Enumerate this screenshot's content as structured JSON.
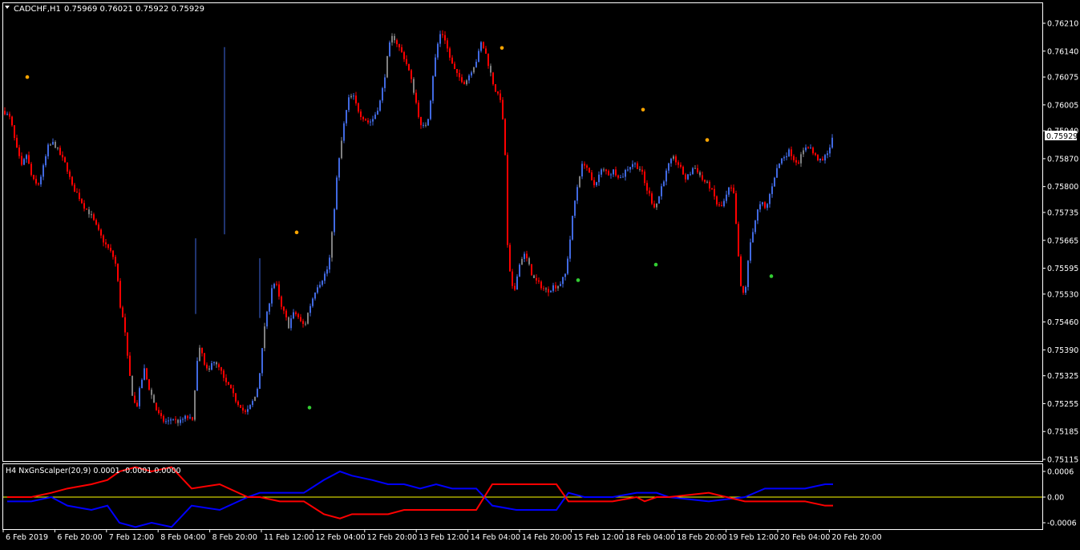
{
  "window": {
    "symbol_title": "CADCHF,H1",
    "quote": "0.75969 0.76021 0.75922 0.75929",
    "current_price_label": "0.75929"
  },
  "indicator": {
    "title": "H4 NxGnScalper(20,9) 0.0001 -0.0001 0.0000"
  },
  "colors": {
    "background": "#000000",
    "frame": "#ffffff",
    "bull_candle": "#4169e1",
    "bear_candle": "#ff0000",
    "neutral_candle": "#808080",
    "signal_sell": "#ffa500",
    "signal_buy": "#32cd32",
    "indicator_blue": "#0000ff",
    "indicator_red": "#ff0000",
    "zero_line": "#ffff00"
  },
  "chart_data": [
    {
      "type": "candlestick",
      "symbol": "CADCHF",
      "timeframe": "H1",
      "ohlc_last": {
        "open": 0.75969,
        "high": 0.76021,
        "low": 0.75922,
        "close": 0.75929
      },
      "y_ticks": [
        "0.76210",
        "0.76140",
        "0.76075",
        "0.76005",
        "0.75940",
        "0.75870",
        "0.75800",
        "0.75735",
        "0.75665",
        "0.75595",
        "0.75530",
        "0.75460",
        "0.75390",
        "0.75325",
        "0.75255",
        "0.75185",
        "0.75115"
      ],
      "ylim": [
        0.75115,
        0.7621
      ],
      "x_ticks": [
        "6 Feb 2019",
        "6 Feb 20:00",
        "7 Feb 12:00",
        "8 Feb 04:00",
        "8 Feb 20:00",
        "11 Feb 12:00",
        "12 Feb 04:00",
        "12 Feb 20:00",
        "13 Feb 12:00",
        "14 Feb 04:00",
        "14 Feb 20:00",
        "15 Feb 12:00",
        "18 Feb 04:00",
        "18 Feb 20:00",
        "19 Feb 12:00",
        "20 Feb 04:00",
        "20 Feb 20:00"
      ],
      "close_path": [
        [
          0,
          0.7599
        ],
        [
          8,
          0.7597
        ],
        [
          15,
          0.759
        ],
        [
          22,
          0.7585
        ],
        [
          28,
          0.7588
        ],
        [
          35,
          0.7582
        ],
        [
          42,
          0.758
        ],
        [
          48,
          0.7584
        ],
        [
          55,
          0.759
        ],
        [
          62,
          0.7591
        ],
        [
          70,
          0.7588
        ],
        [
          78,
          0.7585
        ],
        [
          85,
          0.758
        ],
        [
          92,
          0.7578
        ],
        [
          100,
          0.7575
        ],
        [
          108,
          0.7573
        ],
        [
          115,
          0.757
        ],
        [
          122,
          0.7567
        ],
        [
          128,
          0.7565
        ],
        [
          135,
          0.7563
        ],
        [
          140,
          0.756
        ],
        [
          145,
          0.755
        ],
        [
          150,
          0.7545
        ],
        [
          155,
          0.7535
        ],
        [
          160,
          0.7528
        ],
        [
          165,
          0.7524
        ],
        [
          170,
          0.753
        ],
        [
          175,
          0.7534
        ],
        [
          180,
          0.753
        ],
        [
          185,
          0.7527
        ],
        [
          190,
          0.7524
        ],
        [
          195,
          0.7522
        ],
        [
          200,
          0.7521
        ],
        [
          205,
          0.7521
        ],
        [
          210,
          0.7522
        ],
        [
          215,
          0.7521
        ],
        [
          220,
          0.7521
        ],
        [
          225,
          0.7522
        ],
        [
          230,
          0.7522
        ],
        [
          235,
          0.7521
        ],
        [
          240,
          0.7535
        ],
        [
          245,
          0.754
        ],
        [
          250,
          0.7535
        ],
        [
          255,
          0.7533
        ],
        [
          260,
          0.7537
        ],
        [
          265,
          0.7535
        ],
        [
          270,
          0.7534
        ],
        [
          275,
          0.7531
        ],
        [
          280,
          0.753
        ],
        [
          285,
          0.7528
        ],
        [
          290,
          0.7526
        ],
        [
          295,
          0.7525
        ],
        [
          300,
          0.7523
        ],
        [
          305,
          0.7524
        ],
        [
          310,
          0.7526
        ],
        [
          315,
          0.7528
        ],
        [
          320,
          0.7535
        ],
        [
          325,
          0.7545
        ],
        [
          330,
          0.755
        ],
        [
          335,
          0.7556
        ],
        [
          340,
          0.7555
        ],
        [
          345,
          0.755
        ],
        [
          350,
          0.7548
        ],
        [
          355,
          0.7545
        ],
        [
          360,
          0.7548
        ],
        [
          365,
          0.7548
        ],
        [
          370,
          0.7546
        ],
        [
          375,
          0.7545
        ],
        [
          380,
          0.7549
        ],
        [
          385,
          0.7552
        ],
        [
          390,
          0.7555
        ],
        [
          395,
          0.7556
        ],
        [
          400,
          0.7558
        ],
        [
          405,
          0.756
        ],
        [
          410,
          0.757
        ],
        [
          415,
          0.7582
        ],
        [
          420,
          0.759
        ],
        [
          425,
          0.7597
        ],
        [
          430,
          0.7602
        ],
        [
          435,
          0.7603
        ],
        [
          440,
          0.76
        ],
        [
          445,
          0.7598
        ],
        [
          450,
          0.7597
        ],
        [
          455,
          0.7596
        ],
        [
          460,
          0.7597
        ],
        [
          465,
          0.7599
        ],
        [
          470,
          0.7602
        ],
        [
          475,
          0.7608
        ],
        [
          480,
          0.7615
        ],
        [
          485,
          0.7618
        ],
        [
          490,
          0.7616
        ],
        [
          495,
          0.7614
        ],
        [
          500,
          0.7612
        ],
        [
          505,
          0.7609
        ],
        [
          510,
          0.7605
        ],
        [
          515,
          0.76
        ],
        [
          520,
          0.7595
        ],
        [
          525,
          0.7595
        ],
        [
          530,
          0.7598
        ],
        [
          535,
          0.7608
        ],
        [
          540,
          0.7615
        ],
        [
          545,
          0.7619
        ],
        [
          550,
          0.7617
        ],
        [
          555,
          0.7613
        ],
        [
          560,
          0.761
        ],
        [
          565,
          0.7608
        ],
        [
          570,
          0.7607
        ],
        [
          575,
          0.7606
        ],
        [
          580,
          0.7608
        ],
        [
          585,
          0.761
        ],
        [
          590,
          0.7612
        ],
        [
          595,
          0.7616
        ],
        [
          600,
          0.7614
        ],
        [
          605,
          0.761
        ],
        [
          610,
          0.7606
        ],
        [
          615,
          0.7603
        ],
        [
          620,
          0.7602
        ],
        [
          625,
          0.7588
        ],
        [
          628,
          0.7565
        ],
        [
          632,
          0.7556
        ],
        [
          636,
          0.7553
        ],
        [
          640,
          0.7558
        ],
        [
          645,
          0.7562
        ],
        [
          650,
          0.7563
        ],
        [
          655,
          0.756
        ],
        [
          660,
          0.7557
        ],
        [
          665,
          0.7556
        ],
        [
          670,
          0.7555
        ],
        [
          675,
          0.7554
        ],
        [
          680,
          0.7554
        ],
        [
          685,
          0.7555
        ],
        [
          690,
          0.7555
        ],
        [
          695,
          0.7556
        ],
        [
          700,
          0.7558
        ],
        [
          705,
          0.7565
        ],
        [
          710,
          0.7574
        ],
        [
          715,
          0.758
        ],
        [
          720,
          0.7585
        ],
        [
          725,
          0.7586
        ],
        [
          730,
          0.7583
        ],
        [
          735,
          0.758
        ],
        [
          740,
          0.7582
        ],
        [
          745,
          0.7584
        ],
        [
          750,
          0.7584
        ],
        [
          755,
          0.7583
        ],
        [
          760,
          0.7584
        ],
        [
          765,
          0.7583
        ],
        [
          770,
          0.7582
        ],
        [
          775,
          0.7584
        ],
        [
          780,
          0.7585
        ],
        [
          785,
          0.7586
        ],
        [
          790,
          0.7585
        ],
        [
          795,
          0.7584
        ],
        [
          800,
          0.758
        ],
        [
          805,
          0.7578
        ],
        [
          810,
          0.7575
        ],
        [
          815,
          0.7576
        ],
        [
          820,
          0.758
        ],
        [
          825,
          0.7583
        ],
        [
          830,
          0.7586
        ],
        [
          835,
          0.7587
        ],
        [
          840,
          0.7586
        ],
        [
          845,
          0.7584
        ],
        [
          850,
          0.7582
        ],
        [
          855,
          0.7583
        ],
        [
          860,
          0.7585
        ],
        [
          865,
          0.7584
        ],
        [
          870,
          0.7582
        ],
        [
          875,
          0.7581
        ],
        [
          880,
          0.758
        ],
        [
          885,
          0.7578
        ],
        [
          890,
          0.7575
        ],
        [
          895,
          0.7575
        ],
        [
          900,
          0.7577
        ],
        [
          905,
          0.758
        ],
        [
          910,
          0.7578
        ],
        [
          915,
          0.7565
        ],
        [
          920,
          0.7552
        ],
        [
          925,
          0.7555
        ],
        [
          930,
          0.7565
        ],
        [
          935,
          0.757
        ],
        [
          940,
          0.7574
        ],
        [
          945,
          0.7576
        ],
        [
          950,
          0.7574
        ],
        [
          955,
          0.7578
        ],
        [
          960,
          0.7582
        ],
        [
          965,
          0.7585
        ],
        [
          970,
          0.7587
        ],
        [
          975,
          0.7588
        ],
        [
          980,
          0.7589
        ],
        [
          985,
          0.7587
        ],
        [
          990,
          0.7586
        ],
        [
          995,
          0.7588
        ],
        [
          1000,
          0.759
        ],
        [
          1005,
          0.759
        ],
        [
          1010,
          0.7588
        ],
        [
          1015,
          0.7587
        ],
        [
          1020,
          0.7586
        ],
        [
          1025,
          0.7588
        ],
        [
          1030,
          0.759
        ],
        [
          1035,
          0.7593
        ]
      ],
      "tall_spikes": [
        [
          276,
          0.7568,
          0.7615
        ],
        [
          240,
          0.7548,
          0.7567
        ],
        [
          320,
          0.7547,
          0.7562
        ]
      ],
      "signals_sell": [
        [
          30,
          0.76075
        ],
        [
          366,
          0.75685
        ],
        [
          622,
          0.76148
        ],
        [
          798,
          0.75993
        ],
        [
          878,
          0.75917
        ]
      ],
      "signals_buy": [
        [
          382,
          0.75245
        ],
        [
          717,
          0.75565
        ],
        [
          814,
          0.75604
        ],
        [
          958,
          0.75575
        ]
      ]
    },
    {
      "type": "line",
      "name": "H4 NxGnScalper(20,9)",
      "values_shown": [
        0.0001,
        -0.0001,
        0.0
      ],
      "y_ticks": [
        "0.0006",
        "0.00",
        "-0.0006"
      ],
      "ylim": [
        -0.0006,
        0.0006
      ],
      "series": [
        {
          "name": "",
          "color": "#0000ff",
          "steps": [
            [
              5,
              -0.0001
            ],
            [
              35,
              -0.0001
            ],
            [
              60,
              0
            ],
            [
              80,
              -0.0002
            ],
            [
              110,
              -0.0003
            ],
            [
              130,
              -0.0002
            ],
            [
              145,
              -0.0006
            ],
            [
              165,
              -0.0007
            ],
            [
              185,
              -0.0006
            ],
            [
              210,
              -0.0007
            ],
            [
              235,
              -0.0002
            ],
            [
              270,
              -0.0003
            ],
            [
              305,
              0
            ],
            [
              320,
              0.0001
            ],
            [
              345,
              0.0001
            ],
            [
              375,
              0.0001
            ],
            [
              400,
              0.0004
            ],
            [
              420,
              0.0006
            ],
            [
              435,
              0.0005
            ],
            [
              460,
              0.0004
            ],
            [
              480,
              0.0003
            ],
            [
              500,
              0.0003
            ],
            [
              520,
              0.0002
            ],
            [
              540,
              0.0003
            ],
            [
              560,
              0.0002
            ],
            [
              590,
              0.0002
            ],
            [
              610,
              -0.0002
            ],
            [
              640,
              -0.0003
            ],
            [
              690,
              -0.0003
            ],
            [
              705,
              0.0001
            ],
            [
              725,
              0
            ],
            [
              760,
              0
            ],
            [
              790,
              0.0001
            ],
            [
              800,
              0.0001
            ],
            [
              815,
              0.0001
            ],
            [
              830,
              0
            ],
            [
              880,
              -0.0001
            ],
            [
              925,
              0
            ],
            [
              950,
              0.0002
            ],
            [
              1000,
              0.0002
            ],
            [
              1025,
              0.0003
            ],
            [
              1035,
              0.0003
            ]
          ]
        },
        {
          "name": "",
          "color": "#ff0000",
          "steps": [
            [
              5,
              0
            ],
            [
              35,
              0
            ],
            [
              60,
              0.0001
            ],
            [
              80,
              0.0002
            ],
            [
              110,
              0.0003
            ],
            [
              130,
              0.0004
            ],
            [
              145,
              0.0006
            ],
            [
              165,
              0.0007
            ],
            [
              185,
              0.0006
            ],
            [
              210,
              0.0007
            ],
            [
              235,
              0.0002
            ],
            [
              270,
              0.0003
            ],
            [
              305,
              0
            ],
            [
              320,
              0
            ],
            [
              345,
              -0.0001
            ],
            [
              375,
              -0.0001
            ],
            [
              400,
              -0.0004
            ],
            [
              420,
              -0.0005
            ],
            [
              435,
              -0.0004
            ],
            [
              460,
              -0.0004
            ],
            [
              480,
              -0.0004
            ],
            [
              500,
              -0.0003
            ],
            [
              520,
              -0.0003
            ],
            [
              540,
              -0.0003
            ],
            [
              560,
              -0.0003
            ],
            [
              590,
              -0.0003
            ],
            [
              610,
              0.0003
            ],
            [
              640,
              0.0003
            ],
            [
              690,
              0.0003
            ],
            [
              705,
              -0.0001
            ],
            [
              725,
              -0.0001
            ],
            [
              760,
              -0.0001
            ],
            [
              790,
              0
            ],
            [
              800,
              -0.0001
            ],
            [
              815,
              0
            ],
            [
              830,
              0
            ],
            [
              880,
              0.0001
            ],
            [
              925,
              -0.0001
            ],
            [
              950,
              -0.0001
            ],
            [
              1000,
              -0.0001
            ],
            [
              1025,
              -0.0002
            ],
            [
              1035,
              -0.0002
            ]
          ]
        }
      ]
    }
  ]
}
